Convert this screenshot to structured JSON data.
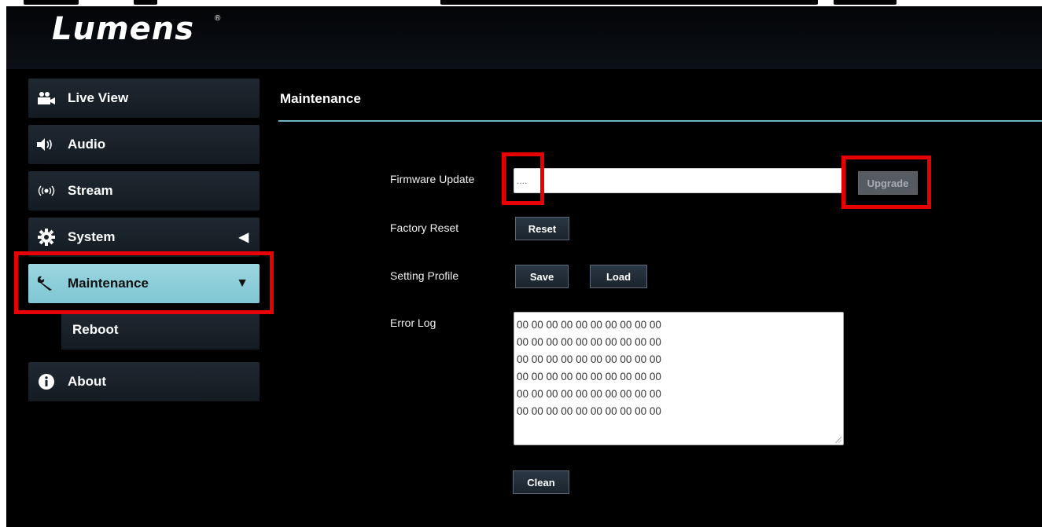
{
  "brand": {
    "logo": "Lumens",
    "registered": "®"
  },
  "sidebar": {
    "items": [
      {
        "label": "Live View",
        "icon": "video-camera-icon"
      },
      {
        "label": "Audio",
        "icon": "speaker-icon"
      },
      {
        "label": "Stream",
        "icon": "broadcast-icon"
      },
      {
        "label": "System",
        "icon": "gear-icon",
        "caret": "◀"
      },
      {
        "label": "Maintenance",
        "icon": "wrench-icon",
        "caret": "▼",
        "active": true
      },
      {
        "label": "Reboot",
        "sub": true
      },
      {
        "label": "About",
        "icon": "info-icon"
      }
    ]
  },
  "main": {
    "title": "Maintenance",
    "firmware": {
      "label": "Firmware Update",
      "value": "....",
      "upgrade_label": "Upgrade",
      "upgrade_disabled": true
    },
    "factory_reset": {
      "label": "Factory Reset",
      "reset_label": "Reset"
    },
    "setting_profile": {
      "label": "Setting Profile",
      "save_label": "Save",
      "load_label": "Load"
    },
    "error_log": {
      "label": "Error Log",
      "lines": [
        "00 00 00 00 00 00 00 00 00 00",
        "00 00 00 00 00 00 00 00 00 00",
        "00 00 00 00 00 00 00 00 00 00",
        "00 00 00 00 00 00 00 00 00 00",
        "00 00 00 00 00 00 00 00 00 00",
        "00 00 00 00 00 00 00 00 00 00"
      ],
      "clean_label": "Clean"
    }
  },
  "colors": {
    "accent": "#7fc6d2",
    "highlight": "#e60000",
    "background": "#000000"
  }
}
